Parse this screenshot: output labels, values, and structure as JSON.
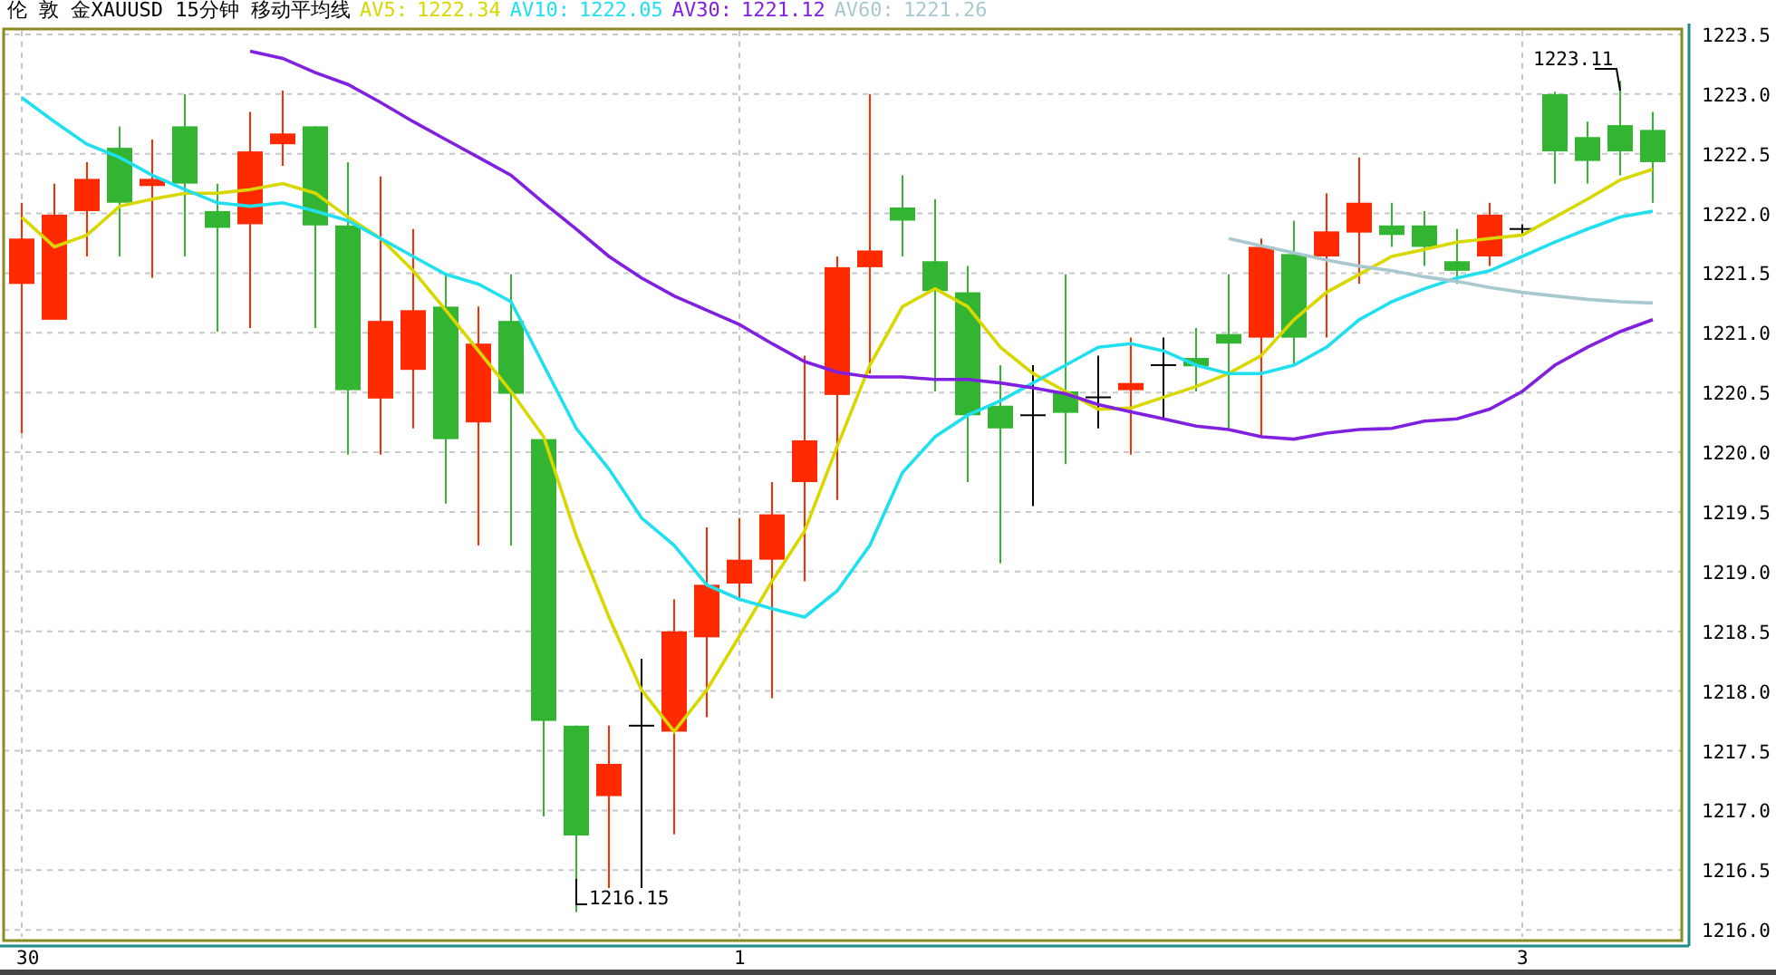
{
  "header": {
    "title": "伦 敦 金XAUUSD 15分钟 移动平均线",
    "averages": [
      {
        "label": "AV5:",
        "value": "1222.34",
        "color": "#d8d800"
      },
      {
        "label": "AV10:",
        "value": "1222.05",
        "color": "#20e0f0"
      },
      {
        "label": "AV30:",
        "value": "1221.12",
        "color": "#8020e0"
      },
      {
        "label": "AV60:",
        "value": "1221.26",
        "color": "#a8c8d0"
      }
    ]
  },
  "chart": {
    "high_label": "1223.11",
    "low_label": "1216.15",
    "price_chart": {
      "chart_data": {
        "type": "candlestick",
        "grid": true,
        "categories": [
          "30",
          null,
          null,
          null,
          null,
          null,
          null,
          null,
          null,
          null,
          null,
          null,
          null,
          null,
          null,
          null,
          null,
          null,
          null,
          null,
          null,
          null,
          "1",
          null,
          null,
          null,
          null,
          null,
          null,
          null,
          null,
          null,
          null,
          null,
          null,
          null,
          null,
          null,
          null,
          null,
          null,
          null,
          null,
          null,
          null,
          null,
          "3",
          null,
          null,
          null,
          null
        ],
        "ohlc": [
          [
            1221.41,
            1222.09,
            1220.16,
            1221.79
          ],
          [
            1221.11,
            1222.25,
            1221.11,
            1221.99
          ],
          [
            1222.02,
            1222.43,
            1221.64,
            1222.29
          ],
          [
            1222.55,
            1222.73,
            1221.64,
            1222.09
          ],
          [
            1222.23,
            1222.62,
            1221.46,
            1222.29
          ],
          [
            1222.73,
            1223.0,
            1221.64,
            1222.25
          ],
          [
            1222.02,
            1222.25,
            1221.01,
            1221.88
          ],
          [
            1221.91,
            1222.85,
            1221.04,
            1222.52
          ],
          [
            1222.58,
            1223.03,
            1222.4,
            1222.67
          ],
          [
            1222.73,
            1222.73,
            1221.04,
            1221.9
          ],
          [
            1221.9,
            1222.43,
            1219.98,
            1220.52
          ],
          [
            1220.45,
            1222.31,
            1219.98,
            1221.1
          ],
          [
            1220.69,
            1221.87,
            1220.2,
            1221.19
          ],
          [
            1221.22,
            1221.49,
            1219.57,
            1220.11
          ],
          [
            1220.25,
            1221.22,
            1219.22,
            1220.91
          ],
          [
            1221.1,
            1221.49,
            1219.22,
            1220.49
          ],
          [
            1220.11,
            1220.11,
            1216.95,
            1217.75
          ],
          [
            1217.71,
            1217.71,
            1216.15,
            1216.79
          ],
          [
            1217.12,
            1217.71,
            1216.35,
            1217.39
          ],
          [
            1217.71,
            1218.27,
            1216.35,
            1217.71
          ],
          [
            1217.66,
            1218.77,
            1216.8,
            1218.5
          ],
          [
            1218.45,
            1219.37,
            1217.78,
            1218.89
          ],
          [
            1218.9,
            1219.45,
            1218.77,
            1219.1
          ],
          [
            1219.1,
            1219.75,
            1217.94,
            1219.48
          ],
          [
            1219.75,
            1220.81,
            1218.92,
            1220.1
          ],
          [
            1220.48,
            1221.64,
            1219.6,
            1221.55
          ],
          [
            1221.55,
            1223.0,
            1220.66,
            1221.69
          ],
          [
            1222.05,
            1222.32,
            1221.64,
            1221.94
          ],
          [
            1221.6,
            1222.12,
            1220.51,
            1221.35
          ],
          [
            1221.34,
            1221.56,
            1219.75,
            1220.31
          ],
          [
            1220.39,
            1220.73,
            1219.07,
            1220.2
          ],
          [
            1220.31,
            1220.73,
            1219.55,
            1220.31
          ],
          [
            1220.51,
            1221.49,
            1219.9,
            1220.33
          ],
          [
            1220.46,
            1220.81,
            1220.2,
            1220.46
          ],
          [
            1220.52,
            1220.96,
            1219.98,
            1220.58
          ],
          [
            1220.73,
            1220.96,
            1220.28,
            1220.73
          ],
          [
            1220.79,
            1221.04,
            1220.51,
            1220.72
          ],
          [
            1220.99,
            1221.49,
            1220.2,
            1220.91
          ],
          [
            1220.96,
            1221.79,
            1220.13,
            1221.72
          ],
          [
            1221.66,
            1221.94,
            1220.73,
            1220.96
          ],
          [
            1221.64,
            1222.17,
            1220.96,
            1221.85
          ],
          [
            1221.84,
            1222.47,
            1221.41,
            1222.09
          ],
          [
            1221.9,
            1222.09,
            1221.72,
            1221.82
          ],
          [
            1221.9,
            1222.02,
            1221.56,
            1221.72
          ],
          [
            1221.6,
            1221.87,
            1221.41,
            1221.52
          ],
          [
            1221.64,
            1222.09,
            1221.56,
            1221.99
          ],
          [
            1221.87,
            1221.91,
            1221.82,
            1221.87
          ],
          [
            1223.0,
            1223.02,
            1222.25,
            1222.52
          ],
          [
            1222.64,
            1222.77,
            1222.25,
            1222.44
          ],
          [
            1222.74,
            1223.11,
            1222.32,
            1222.52
          ],
          [
            1222.7,
            1222.85,
            1222.09,
            1222.43
          ]
        ],
        "ylim": [
          1215.91,
          1223.53
        ],
        "yticks": [
          {
            "value": 1223.5,
            "label": "1223.5"
          },
          {
            "value": 1223,
            "label": "1223.0"
          },
          {
            "value": 1222.5,
            "label": "1222.5"
          },
          {
            "value": 1222,
            "label": "1222.0"
          },
          {
            "value": 1221.5,
            "label": "1221.5"
          },
          {
            "value": 1221,
            "label": "1221.0"
          },
          {
            "value": 1220.5,
            "label": "1220.5"
          },
          {
            "value": 1220,
            "label": "1220.0"
          },
          {
            "value": 1219.5,
            "label": "1219.5"
          },
          {
            "value": 1219,
            "label": "1219.0"
          },
          {
            "value": 1218.5,
            "label": "1218.5"
          },
          {
            "value": 1218,
            "label": "1218.0"
          },
          {
            "value": 1217.5,
            "label": "1217.5"
          },
          {
            "value": 1217,
            "label": "1217.0"
          },
          {
            "value": 1216.5,
            "label": "1216.5"
          },
          {
            "value": 1216,
            "label": "1216.0"
          }
        ]
      }
    },
    "average_chart": {
      "chart_data": {
        "type": "line",
        "ylim": [
          1215.91,
          1223.53
        ],
        "series": [
          {
            "color": "#d8d800",
            "values": [
              1221.97,
              1221.72,
              1221.82,
              1222.06,
              1222.12,
              1222.17,
              1222.17,
              1222.2,
              1222.25,
              1222.17,
              1221.97,
              1221.79,
              1221.52,
              1221.19,
              1220.85,
              1220.51,
              1220.13,
              1219.3,
              1218.62,
              1218.01,
              1217.66,
              1218.01,
              1218.46,
              1218.92,
              1219.34,
              1220.05,
              1220.73,
              1221.22,
              1221.37,
              1221.22,
              1220.88,
              1220.66,
              1220.51,
              1220.36,
              1220.37,
              1220.46,
              1220.55,
              1220.66,
              1220.81,
              1221.11,
              1221.34,
              1221.49,
              1221.64,
              1221.7,
              1221.76,
              1221.79,
              1221.82,
              1221.97,
              1222.12,
              1222.28,
              1222.37
            ]
          },
          {
            "color": "#20e0f0",
            "values": [
              1222.97,
              1222.77,
              1222.58,
              1222.47,
              1222.32,
              1222.2,
              1222.09,
              1222.06,
              1222.09,
              1222.02,
              1221.94,
              1221.79,
              1221.64,
              1221.49,
              1221.41,
              1221.26,
              1220.73,
              1220.2,
              1219.86,
              1219.45,
              1219.22,
              1218.89,
              1218.77,
              1218.69,
              1218.62,
              1218.84,
              1219.22,
              1219.83,
              1220.13,
              1220.31,
              1220.43,
              1220.58,
              1220.73,
              1220.88,
              1220.91,
              1220.85,
              1220.73,
              1220.66,
              1220.66,
              1220.73,
              1220.88,
              1221.11,
              1221.26,
              1221.37,
              1221.46,
              1221.52,
              1221.64,
              1221.76,
              1221.87,
              1221.97,
              1222.02
            ]
          },
          {
            "color": "#8020e0",
            "values": [
              null,
              null,
              null,
              null,
              null,
              null,
              null,
              1223.36,
              1223.3,
              1223.18,
              1223.08,
              1222.93,
              1222.77,
              1222.62,
              1222.47,
              1222.32,
              1222.09,
              1221.87,
              1221.64,
              1221.46,
              1221.31,
              1221.19,
              1221.07,
              1220.91,
              1220.76,
              1220.67,
              1220.63,
              1220.63,
              1220.61,
              1220.61,
              1220.58,
              1220.54,
              1220.49,
              1220.4,
              1220.34,
              1220.28,
              1220.22,
              1220.19,
              1220.13,
              1220.11,
              1220.16,
              1220.19,
              1220.2,
              1220.26,
              1220.28,
              1220.36,
              1220.51,
              1220.73,
              1220.88,
              1221.01,
              1221.11
            ]
          },
          {
            "color": "#a8c8d0",
            "values": [
              null,
              null,
              null,
              null,
              null,
              null,
              null,
              null,
              null,
              null,
              null,
              null,
              null,
              null,
              null,
              null,
              null,
              null,
              null,
              null,
              null,
              null,
              null,
              null,
              null,
              null,
              null,
              null,
              null,
              null,
              null,
              null,
              null,
              null,
              null,
              null,
              null,
              1221.79,
              1221.73,
              1221.67,
              1221.61,
              1221.56,
              1221.52,
              1221.47,
              1221.43,
              1221.38,
              1221.34,
              1221.31,
              1221.28,
              1221.26,
              1221.25
            ]
          }
        ]
      }
    }
  }
}
